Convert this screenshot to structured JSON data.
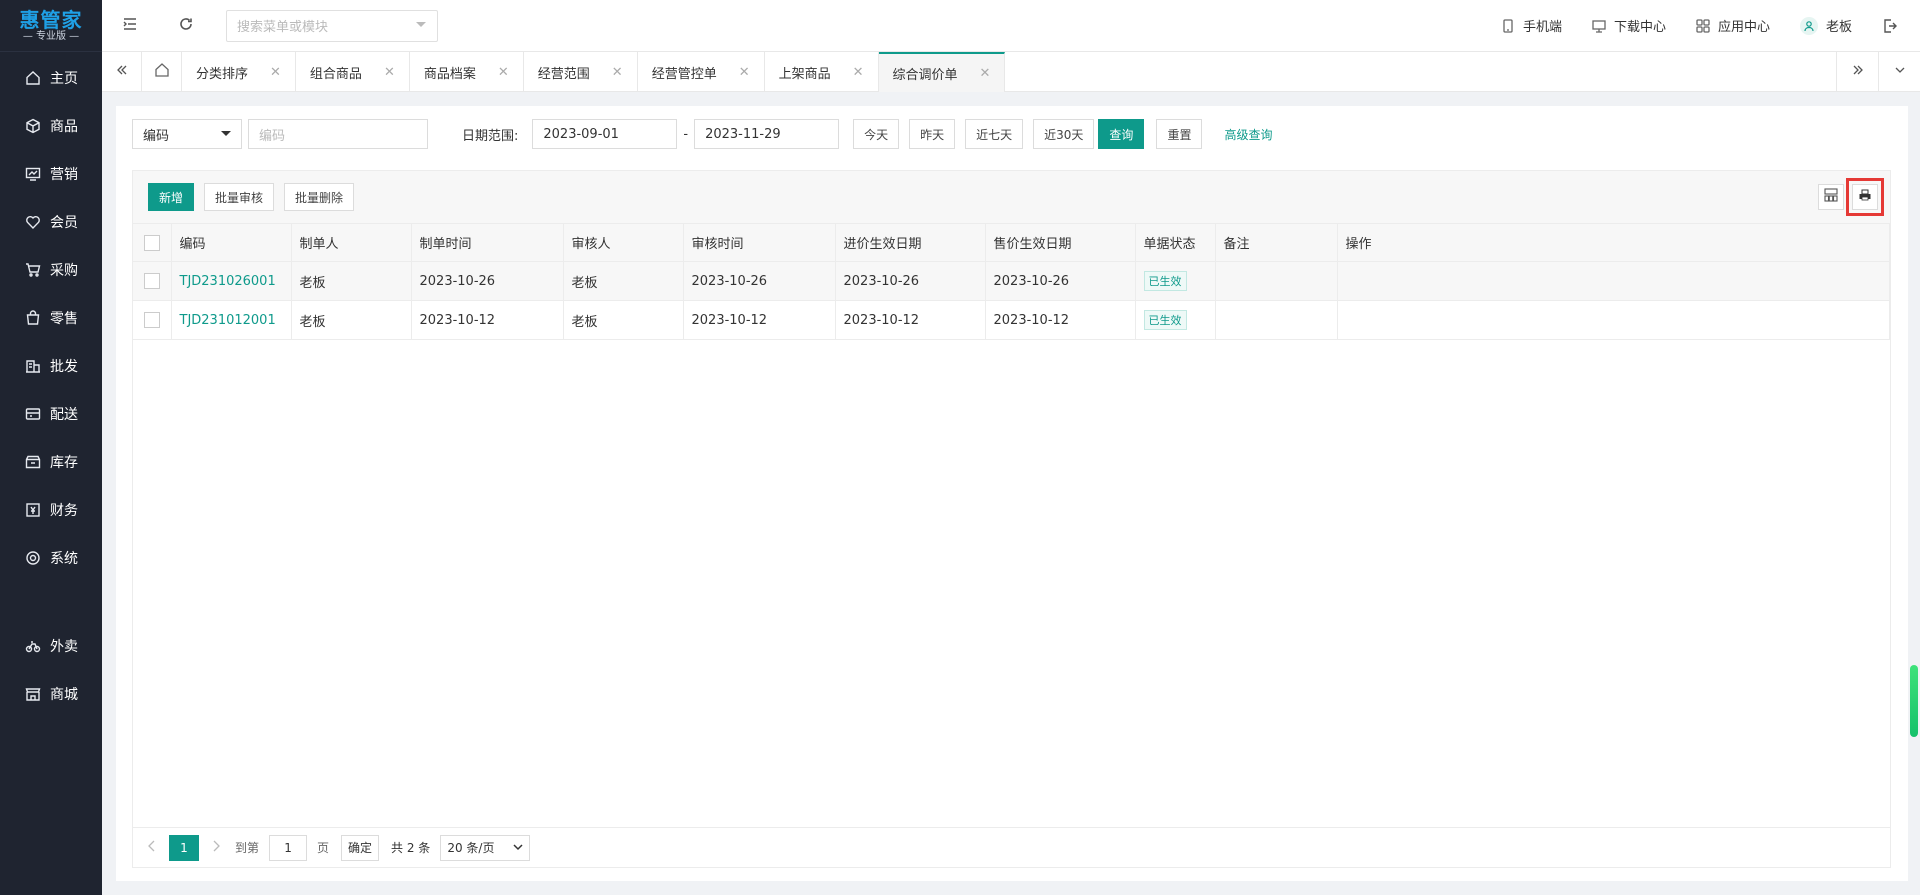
{
  "app": {
    "logo_title": "惠管家",
    "logo_sub": "— 专业版 —"
  },
  "sidebar": {
    "items": [
      {
        "label": "主页",
        "icon": "home-icon"
      },
      {
        "label": "商品",
        "icon": "box-icon"
      },
      {
        "label": "营销",
        "icon": "marketing-icon"
      },
      {
        "label": "会员",
        "icon": "heart-icon"
      },
      {
        "label": "采购",
        "icon": "cart-icon"
      },
      {
        "label": "零售",
        "icon": "bag-icon"
      },
      {
        "label": "批发",
        "icon": "building-icon"
      },
      {
        "label": "配送",
        "icon": "truck-icon"
      },
      {
        "label": "库存",
        "icon": "warehouse-icon"
      },
      {
        "label": "财务",
        "icon": "finance-icon"
      },
      {
        "label": "系统",
        "icon": "settings-icon"
      },
      {
        "label": "外卖",
        "icon": "bike-icon"
      },
      {
        "label": "商城",
        "icon": "store-icon"
      }
    ]
  },
  "header": {
    "search_placeholder": "搜索菜单或模块",
    "mobile": "手机端",
    "download": "下载中心",
    "apps": "应用中心",
    "user": "老板"
  },
  "tabs": [
    {
      "label": "分类排序"
    },
    {
      "label": "组合商品"
    },
    {
      "label": "商品档案"
    },
    {
      "label": "经营范围"
    },
    {
      "label": "经营管控单"
    },
    {
      "label": "上架商品"
    },
    {
      "label": "综合调价单",
      "active": true
    }
  ],
  "filter": {
    "field_select": "编码",
    "field_placeholder": "编码",
    "date_label": "日期范围:",
    "date_start": "2023-09-01",
    "date_sep": "-",
    "date_end": "2023-11-29",
    "today": "今天",
    "yesterday": "昨天",
    "last7": "近七天",
    "last30": "近30天",
    "query": "查询",
    "reset": "重置",
    "advanced": "高级查询"
  },
  "toolbar": {
    "add": "新增",
    "batch_audit": "批量审核",
    "batch_delete": "批量删除"
  },
  "table": {
    "headers": [
      "编码",
      "制单人",
      "制单时间",
      "审核人",
      "审核时间",
      "进价生效日期",
      "售价生效日期",
      "单据状态",
      "备注",
      "操作"
    ],
    "rows": [
      {
        "code": "TJD231026001",
        "creator": "老板",
        "created": "2023-10-26",
        "auditor": "老板",
        "audited": "2023-10-26",
        "cost_date": "2023-10-26",
        "price_date": "2023-10-26",
        "status": "已生效",
        "note": "",
        "ops": ""
      },
      {
        "code": "TJD231012001",
        "creator": "老板",
        "created": "2023-10-12",
        "auditor": "老板",
        "audited": "2023-10-12",
        "cost_date": "2023-10-12",
        "price_date": "2023-10-12",
        "status": "已生效",
        "note": "",
        "ops": ""
      }
    ]
  },
  "pager": {
    "current": "1",
    "goto": "到第",
    "goto_value": "1",
    "page": "页",
    "confirm": "确定",
    "total": "共 2 条",
    "size": "20 条/页"
  },
  "colors": {
    "accent": "#0e9a8b",
    "sidebar_bg": "#1f2430",
    "highlight": "#e53935"
  }
}
